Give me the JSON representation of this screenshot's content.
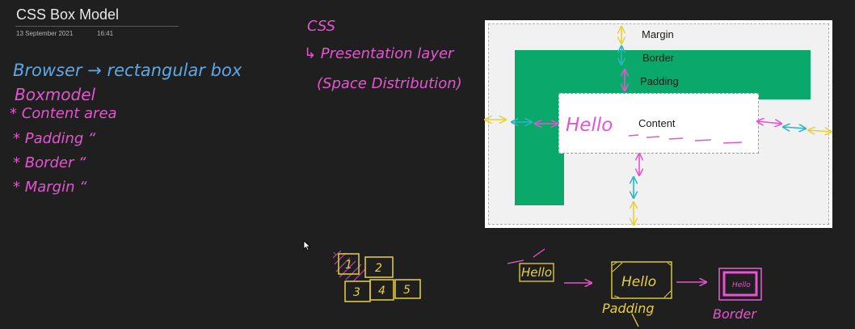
{
  "page": {
    "title": "CSS Box Model",
    "date": "13 September 2021",
    "time": "16:41"
  },
  "notes": {
    "browser_line": "Browser → rectangular box",
    "boxmodel_heading": "Boxmodel",
    "bullets": [
      "* Content area",
      "* Padding “",
      "* Border “",
      "* Margin “"
    ],
    "css_heading": "CSS",
    "css_arrow_line": "↳ Presentation layer",
    "css_paren_line": "(Space Distribution)"
  },
  "diagram": {
    "margin_label": "Margin",
    "border_label": "Border",
    "padding_label": "Padding",
    "content_label": "Content",
    "hello_ink": "Hello"
  },
  "sketch": {
    "grid_boxes": [
      "1",
      "2",
      "3",
      "4",
      "5"
    ],
    "hello_plain": "Hello",
    "hello_padded": "Hello",
    "hello_bordered": "Hello",
    "padding_caption": "Padding",
    "border_caption": "Border"
  },
  "colors": {
    "background": "#1f1f1f",
    "ink_blue": "#5aa8e8",
    "ink_pink": "#e455cf",
    "ink_yellow": "#e8d03a",
    "ink_teal": "#2bb6c4",
    "border_green": "#0aa86a"
  }
}
